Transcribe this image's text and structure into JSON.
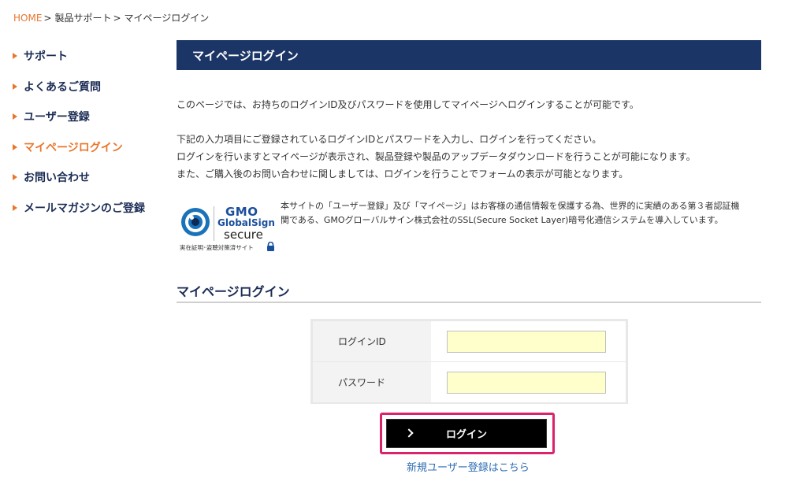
{
  "breadcrumb": {
    "home": "HOME",
    "separator": ">",
    "items": [
      "製品サポート",
      "マイページログイン"
    ]
  },
  "sidebar": {
    "items": [
      {
        "label": "サポート",
        "active": false
      },
      {
        "label": "よくあるご質問",
        "active": false
      },
      {
        "label": "ユーザー登録",
        "active": false
      },
      {
        "label": "マイページログイン",
        "active": true
      },
      {
        "label": "お問い合わせ",
        "active": false
      },
      {
        "label": "メールマガジンのご登録",
        "active": false
      }
    ]
  },
  "header": {
    "title": "マイページログイン"
  },
  "intro": {
    "p1": "このページでは、お持ちのログインID及びパスワードを使用してマイページへログインすることが可能です。",
    "p2": "下記の入力項目にご登録されているログインIDとパスワードを入力し、ログインを行ってください。",
    "p3": "ログインを行いますとマイページが表示され、製品登録や製品のアップデータダウンロードを行うことが可能になります。",
    "p4": "また、ご購入後のお問い合わせに関しましては、ログインを行うことでフォームの表示が可能となります。"
  },
  "gmo_badge": {
    "brand": "GMO",
    "product": "GlobalSign",
    "secure": "secure",
    "caption": "実在証明･盗聴対策済サイト",
    "icons": [
      "eye-icon",
      "lock-icon"
    ]
  },
  "ssl_notice": "本サイトの「ユーザー登録」及び「マイページ」はお客様の通信情報を保護する為、世界的に実績のある第３者認証機関である、GMOグローバルサイン株式会社のSSL(Secure Socket Layer)暗号化通信システムを導入しています。",
  "login_section": {
    "title": "マイページログイン",
    "fields": {
      "login_id": {
        "label": "ログインID",
        "value": ""
      },
      "password": {
        "label": "パスワード",
        "value": ""
      }
    },
    "button_label": "ログイン",
    "register_link": "新規ユーザー登録はこちら"
  },
  "colors": {
    "accent": "#e8762d",
    "navy": "#1b3566",
    "button": "#000000",
    "highlight": "#d9246b",
    "link": "#2e6db4",
    "input_bg": "#ffffcc"
  }
}
